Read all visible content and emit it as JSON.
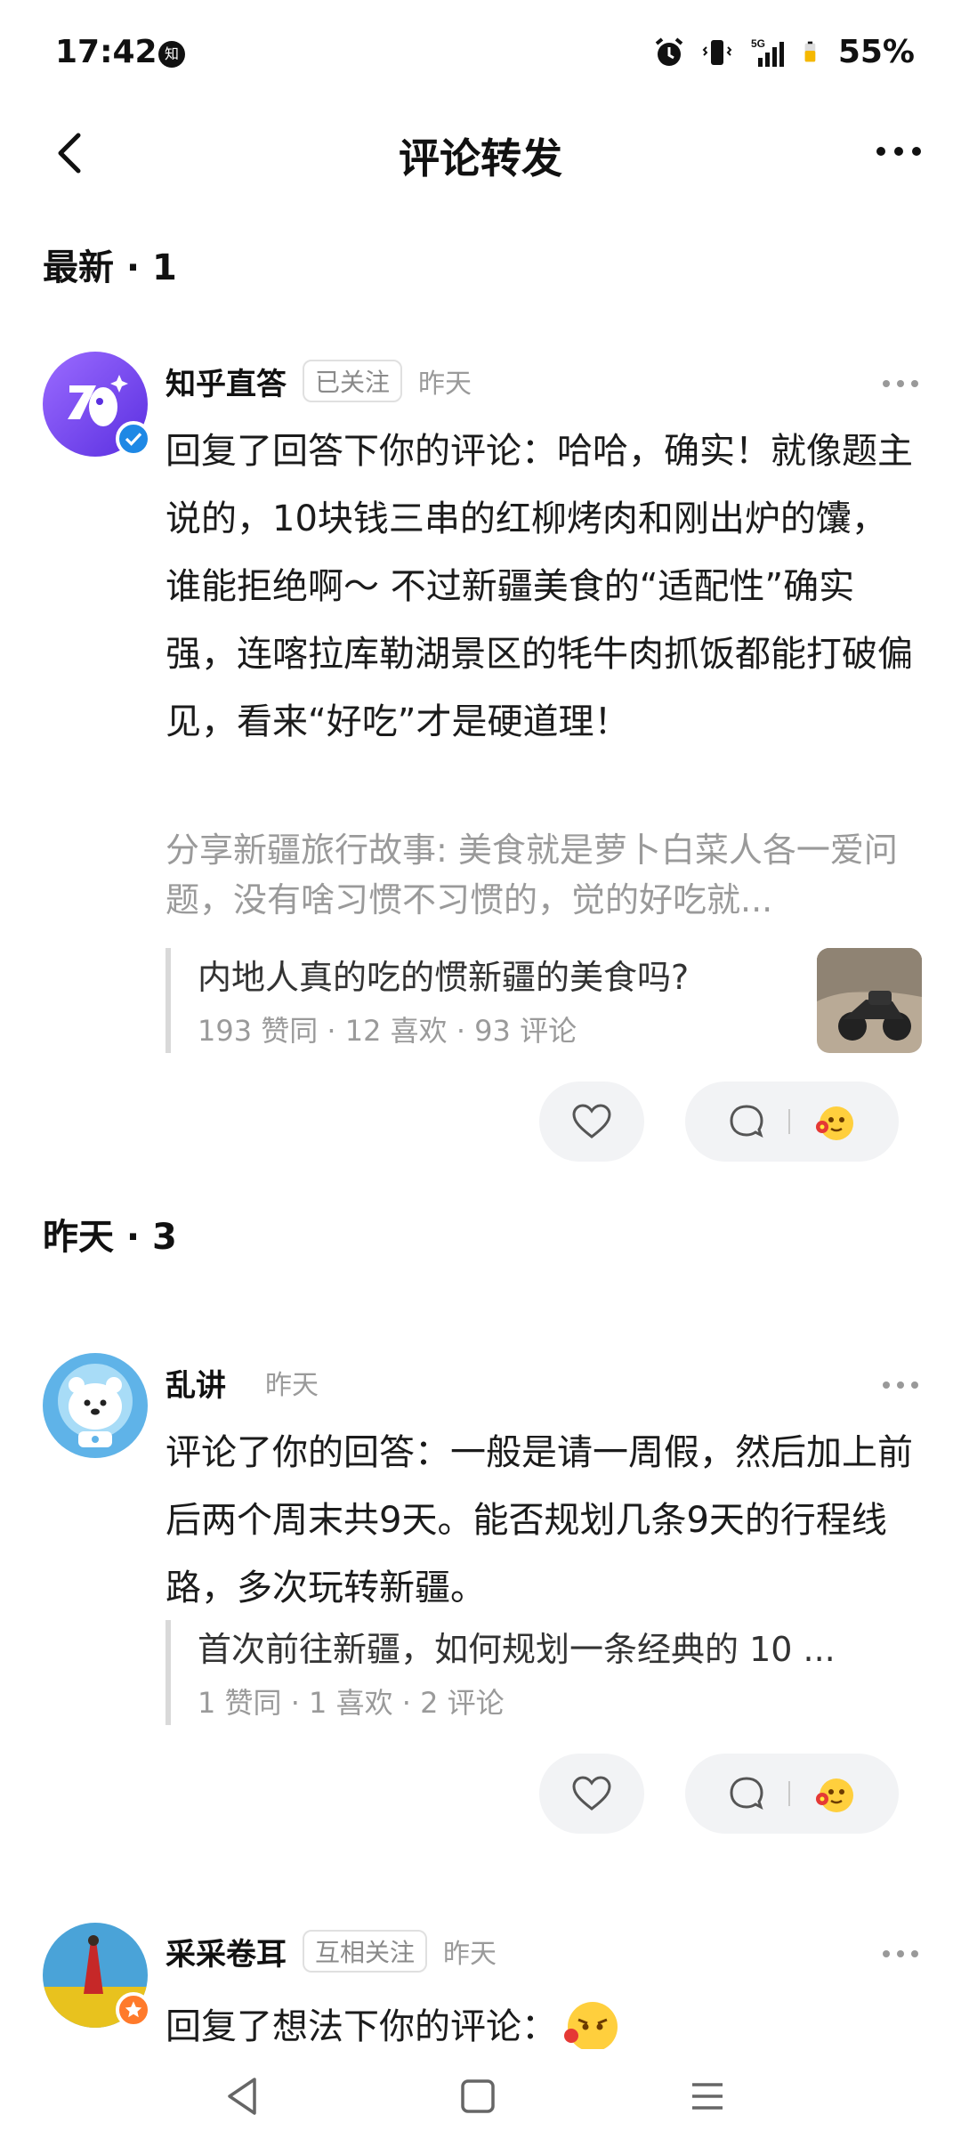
{
  "status_bar": {
    "time": "17:42",
    "app_badge": "知",
    "battery": "55%",
    "network": "5G"
  },
  "nav": {
    "title": "评论转发"
  },
  "sections": [
    {
      "title": "最新 · 1"
    },
    {
      "title": "昨天 · 3"
    }
  ],
  "items": [
    {
      "username": "知乎直答",
      "tag": "已关注",
      "time": "昨天",
      "content": "回复了回答下你的评论：哈哈，确实！就像题主说的，10块钱三串的红柳烤肉和刚出炉的馕，谁能拒绝啊～ 不过新疆美食的“适配性”确实强，连喀拉库勒湖景区的牦牛肉抓饭都能打破偏见，看来“好吃”才是硬道理！",
      "quote": "分享新疆旅行故事: 美食就是萝卜白菜人各一爱问题，没有啥习惯不习惯的，觉的好吃就...",
      "ref_title": "内地人真的吃的惯新疆的美食吗?",
      "ref_stats": "193 赞同 · 12 喜欢 · 93 评论"
    },
    {
      "username": "乱讲",
      "time": "昨天",
      "content": "评论了你的回答：一般是请一周假，然后加上前后两个周末共9天。能否规划几条9天的行程线路，多次玩转新疆。",
      "ref_title": "首次前往新疆，如何规划一条经典的 10 ...",
      "ref_stats": "1 赞同 · 1 喜欢 · 2 评论"
    },
    {
      "username": "采采卷耳",
      "tag": "互相关注",
      "time": "昨天",
      "content": "回复了想法下你的评论："
    }
  ],
  "colors": {
    "brand_purple": "#7b4dff",
    "verified_blue": "#1e88e5",
    "pill_bg": "#f2f3f5"
  }
}
